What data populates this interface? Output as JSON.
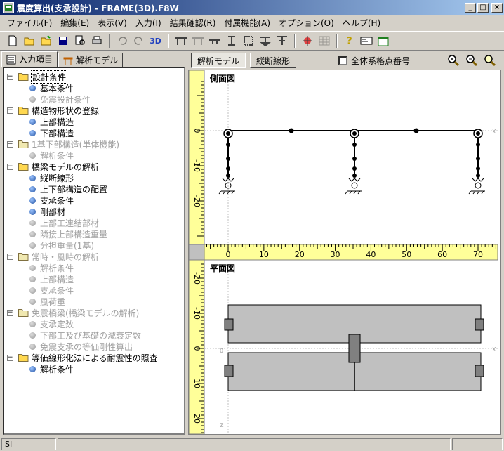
{
  "window": {
    "title": "震度算出(支承設計) - FRAME(3D).F8W"
  },
  "menu": [
    "ファイル(F)",
    "編集(E)",
    "表示(V)",
    "入力(I)",
    "結果確認(R)",
    "付属機能(A)",
    "オプション(O)",
    "ヘルプ(H)"
  ],
  "toolbar": {
    "view3d_label": "3D"
  },
  "left_tabs": {
    "input": "入力項目",
    "model": "解析モデル"
  },
  "tree": [
    {
      "label": "設計条件",
      "level": 0,
      "type": "folder",
      "enabled": true,
      "selected": true
    },
    {
      "label": "基本条件",
      "level": 1,
      "type": "item",
      "enabled": true
    },
    {
      "label": "免震設計条件",
      "level": 1,
      "type": "item",
      "enabled": false
    },
    {
      "label": "構造物形状の登録",
      "level": 0,
      "type": "folder",
      "enabled": true
    },
    {
      "label": "上部構造",
      "level": 1,
      "type": "item",
      "enabled": true
    },
    {
      "label": "下部構造",
      "level": 1,
      "type": "item",
      "enabled": true
    },
    {
      "label": "1基下部構造(単体機能)",
      "level": 0,
      "type": "folder",
      "enabled": false
    },
    {
      "label": "解析条件",
      "level": 1,
      "type": "item",
      "enabled": false
    },
    {
      "label": "橋梁モデルの解析",
      "level": 0,
      "type": "folder",
      "enabled": true
    },
    {
      "label": "縦断線形",
      "level": 1,
      "type": "item",
      "enabled": true
    },
    {
      "label": "上下部構造の配置",
      "level": 1,
      "type": "item",
      "enabled": true
    },
    {
      "label": "支承条件",
      "level": 1,
      "type": "item",
      "enabled": true
    },
    {
      "label": "剛部材",
      "level": 1,
      "type": "item",
      "enabled": true
    },
    {
      "label": "上部工連結部材",
      "level": 1,
      "type": "item",
      "enabled": false
    },
    {
      "label": "隣接上部構造重量",
      "level": 1,
      "type": "item",
      "enabled": false
    },
    {
      "label": "分担重量(1基)",
      "level": 1,
      "type": "item",
      "enabled": false
    },
    {
      "label": "常時・風時の解析",
      "level": 0,
      "type": "folder",
      "enabled": false
    },
    {
      "label": "解析条件",
      "level": 1,
      "type": "item",
      "enabled": false
    },
    {
      "label": "上部構造",
      "level": 1,
      "type": "item",
      "enabled": false
    },
    {
      "label": "支承条件",
      "level": 1,
      "type": "item",
      "enabled": false
    },
    {
      "label": "風荷重",
      "level": 1,
      "type": "item",
      "enabled": false
    },
    {
      "label": "免震橋梁(橋梁モデルの解析)",
      "level": 0,
      "type": "folder",
      "enabled": false
    },
    {
      "label": "支承定数",
      "level": 1,
      "type": "item",
      "enabled": false
    },
    {
      "label": "下部工及び基礎の減衰定数",
      "level": 1,
      "type": "item",
      "enabled": false
    },
    {
      "label": "免震支承の等価剛性算出",
      "level": 1,
      "type": "item",
      "enabled": false
    },
    {
      "label": "等価線形化法による耐震性の照査",
      "level": 0,
      "type": "folder",
      "enabled": true
    },
    {
      "label": "解析条件",
      "level": 1,
      "type": "item",
      "enabled": true
    }
  ],
  "right_tools": {
    "model_btn": "解析モデル",
    "profile_btn": "縦断線形",
    "checkbox_label": "全体系格点番号"
  },
  "side_view": {
    "title": "側面図",
    "v_ticks": [
      "0",
      "-10",
      "-20"
    ],
    "axis_x_label": "X",
    "x_ticks": [
      "0",
      "10",
      "20",
      "30",
      "40",
      "50",
      "60",
      "70"
    ]
  },
  "plan_view": {
    "title": "平面図",
    "v_ticks": [
      "-20",
      "-10",
      "0",
      "10",
      "20"
    ],
    "axis_x_label": "X",
    "axis_z_label": "Z",
    "origin_label": "0"
  },
  "status": {
    "mode": "SI"
  },
  "colors": {
    "title_start": "#0a246a",
    "title_end": "#a6caf0",
    "ruler": "#ffff99",
    "deck": "#c0c0c0",
    "bearing": "#808080"
  }
}
